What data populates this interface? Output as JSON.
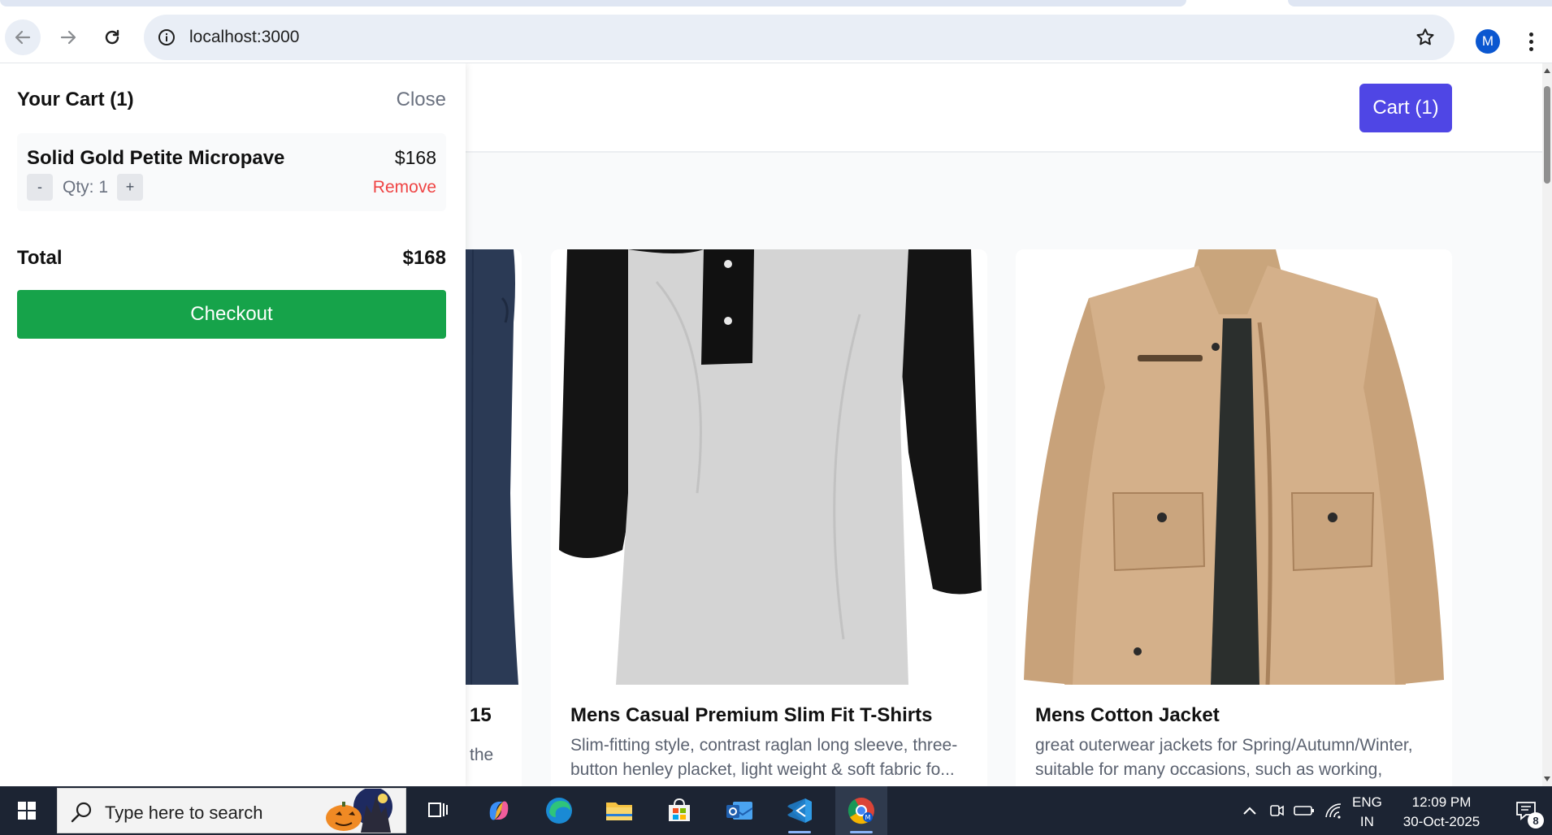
{
  "browser": {
    "url": "localhost:3000",
    "profile_initial": "M",
    "avatar_color": "#0b57d0"
  },
  "site": {
    "cart_button_label": "Cart (1)",
    "accent_color": "#4f46e5"
  },
  "products": [
    {
      "title": "15",
      "description": "the",
      "image_icon": "pants-image"
    },
    {
      "title": "Mens Casual Premium Slim Fit T-Shirts",
      "description": "Slim-fitting style, contrast raglan long sleeve, three-button henley placket, light weight & soft fabric fo...",
      "image_icon": "tshirt-image"
    },
    {
      "title": "Mens Cotton Jacket",
      "description": "great outerwear jackets for Spring/Autumn/Winter, suitable for many occasions, such as working, hikin...",
      "image_icon": "jacket-image"
    }
  ],
  "cart": {
    "title": "Your Cart (1)",
    "close_label": "Close",
    "items": [
      {
        "name": "Solid Gold Petite Micropave",
        "price": "$168",
        "minus_label": "-",
        "qty_label": "Qty: 1",
        "plus_label": "+",
        "remove_label": "Remove"
      }
    ],
    "total_label": "Total",
    "total_value": "$168",
    "checkout_label": "Checkout",
    "checkout_color": "#16a34a",
    "remove_color": "#ef4444"
  },
  "taskbar": {
    "search_placeholder": "Type here to search",
    "language_top": "ENG",
    "language_bottom": "IN",
    "time": "12:09 PM",
    "date": "30-Oct-2025",
    "notification_count": "8",
    "apps": [
      "task-view-icon",
      "copilot-icon",
      "edge-icon",
      "file-explorer-icon",
      "microsoft-store-icon",
      "outlook-icon",
      "vscode-icon",
      "chrome-icon"
    ]
  }
}
